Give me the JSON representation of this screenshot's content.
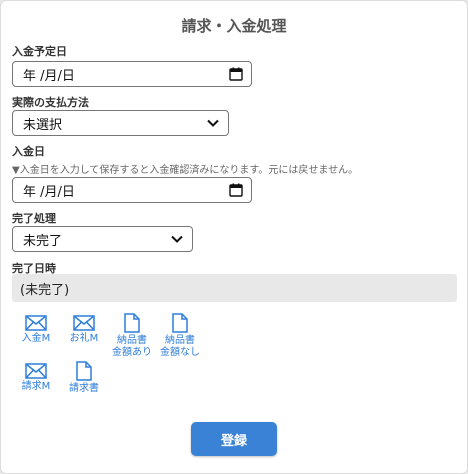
{
  "title": "請求・入金処理",
  "deposit_due": {
    "label": "入金予定日",
    "value": "年 /月/日"
  },
  "payment_method": {
    "label": "実際の支払方法",
    "value": "未選択"
  },
  "deposit_date": {
    "label": "入金日",
    "note": "▼入金日を入力して保存すると入金確認済みになります。元には戻せません。",
    "value": "年 /月/日"
  },
  "completion": {
    "label": "完了処理",
    "value": "未完了"
  },
  "completion_time": {
    "label": "完了日時",
    "value": "(未完了)"
  },
  "actions": [
    {
      "label": "入金M",
      "icon": "mail-icon"
    },
    {
      "label": "お礼M",
      "icon": "mail-icon"
    },
    {
      "label": "納品書",
      "label2": "金額あり",
      "icon": "document-icon"
    },
    {
      "label": "納品書",
      "label2": "金額なし",
      "icon": "document-icon"
    },
    {
      "label": "請求M",
      "icon": "mail-icon"
    },
    {
      "label": "請求書",
      "icon": "document-icon"
    }
  ],
  "submit_label": "登録",
  "colors": {
    "accent": "#3a82d6",
    "icon": "#2f7ed8"
  }
}
